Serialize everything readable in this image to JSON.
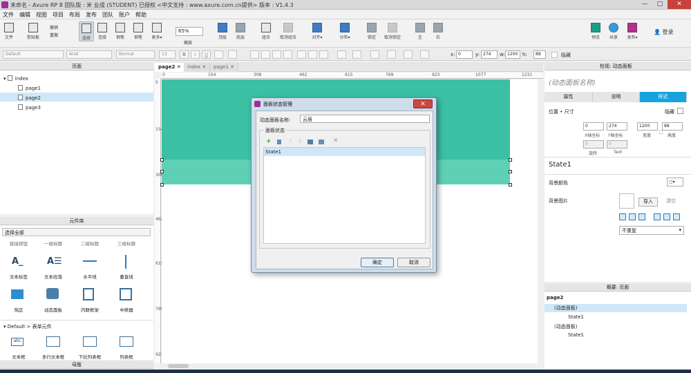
{
  "window": {
    "title": "未命名 - Axure RP 8 团队版 : 米 业成 (STUDENT) 已授权    <中文支持 : www.axure.com.cn提供> 版本 : V1.4.3",
    "min": "—",
    "max": "□",
    "close": "✕"
  },
  "menu": [
    "文件",
    "编辑",
    "视图",
    "项目",
    "布局",
    "发布",
    "团队",
    "账户",
    "帮助"
  ],
  "toolbar": {
    "file": "文件",
    "clipboard": "剪贴板",
    "undo": "撤销",
    "redo": "重做",
    "select": "选择",
    "connect": "连接",
    "pen": "钢笔",
    "more": "更多▾",
    "zoom_value": "65%",
    "zoom_label": "缩放",
    "top": "顶层",
    "bottom": "底层",
    "group": "组合",
    "ungroup": "取消组合",
    "align": "对齐▾",
    "distribute": "分布▾",
    "lock": "锁定",
    "unlock": "取消锁定",
    "left": "左",
    "right": "右",
    "preview": "预览",
    "share": "共享",
    "publish": "发布▾",
    "login": "登录"
  },
  "format": {
    "style": "Default",
    "font": "Arial",
    "weight": "Normal",
    "size": "13",
    "bold": "B",
    "italic": "I",
    "underline": "U",
    "x_label": "x:",
    "x": "0",
    "y_label": "y:",
    "y": "274",
    "w_label": "w:",
    "w": "1200",
    "h_label": "h:",
    "h": "88",
    "hide_label": "隐藏"
  },
  "pages_panel": {
    "title": "页面",
    "root": "index",
    "pages": [
      "page1",
      "page2",
      "page3"
    ],
    "selected": "page2"
  },
  "library": {
    "title": "元件库",
    "select": "选择全部",
    "top_labels": [
      "链接按钮",
      "一级标题",
      "二级标题",
      "三级标题"
    ],
    "row1": [
      "文本标签",
      "文本段落",
      "水平线",
      "垂直线"
    ],
    "row2": [
      "热区",
      "动态面板",
      "内联框架",
      "中继器"
    ],
    "group": "Default > 表单元件",
    "row3": [
      "文本框",
      "多行文本框",
      "下拉列表框",
      "列表框"
    ],
    "bottom": "母版"
  },
  "tabs": [
    "page2",
    "index",
    "page1"
  ],
  "ruler": {
    "h": [
      "0",
      "154",
      "308",
      "462",
      "615",
      "769",
      "923",
      "1077",
      "1231"
    ],
    "v": [
      "0",
      "154",
      "308",
      "462",
      "615",
      "769",
      "923"
    ]
  },
  "dialog": {
    "title": "面板状态管理",
    "name_label": "动态面板名称:",
    "name_value": "云层",
    "group_label": "面板状态",
    "states": [
      "State1"
    ],
    "ok": "确定",
    "cancel": "取消"
  },
  "inspector": {
    "header": "检视: 动态面板",
    "name": "(动态面板名称)",
    "tabs": [
      "属性",
      "说明",
      "样式"
    ],
    "active_tab": "样式",
    "pos_label": "位置 • 尺寸",
    "hide": "隐藏",
    "x": "0",
    "y": "274",
    "w": "1200",
    "h": "88",
    "x_lbl": "X轴坐标",
    "y_lbl": "Y轴坐标",
    "w_lbl": "宽度",
    "h_lbl": "高度",
    "rot": "0",
    "text_rot": "0",
    "rot_lbl": "旋转",
    "text_lbl": "Text",
    "state": "State1",
    "bg_color": "背景颜色",
    "bg_image": "背景图片",
    "import": "导入",
    "clear": "清空",
    "repeat": "不重复"
  },
  "outline": {
    "title": "概要: 页面",
    "page": "page2",
    "items": [
      "(动态面板)",
      "State1",
      "(动态面板)",
      "State1"
    ]
  },
  "colors": {
    "teal": "#3cc0a4",
    "teal_light": "#5fd0b6",
    "accent": "#16a3e0"
  }
}
